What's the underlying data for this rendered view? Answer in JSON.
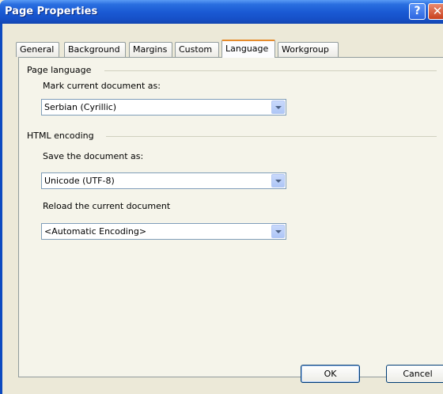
{
  "window": {
    "title": "Page Properties",
    "help_glyph": "?",
    "close_glyph": "✕"
  },
  "tabs": [
    {
      "label": "General"
    },
    {
      "label": "Background"
    },
    {
      "label": "Margins"
    },
    {
      "label": "Custom"
    },
    {
      "label": "Language",
      "active": true
    },
    {
      "label": "Workgroup"
    }
  ],
  "page_language": {
    "group_label": "Page language",
    "mark_label": "Mark current document as:",
    "mark_value": "Serbian (Cyrillic)"
  },
  "html_encoding": {
    "group_label": "HTML encoding",
    "save_label": "Save the document as:",
    "save_value": "Unicode (UTF-8)",
    "reload_label": "Reload the current document",
    "reload_value": "<Automatic Encoding>"
  },
  "buttons": {
    "ok": "OK",
    "cancel": "Cancel"
  }
}
